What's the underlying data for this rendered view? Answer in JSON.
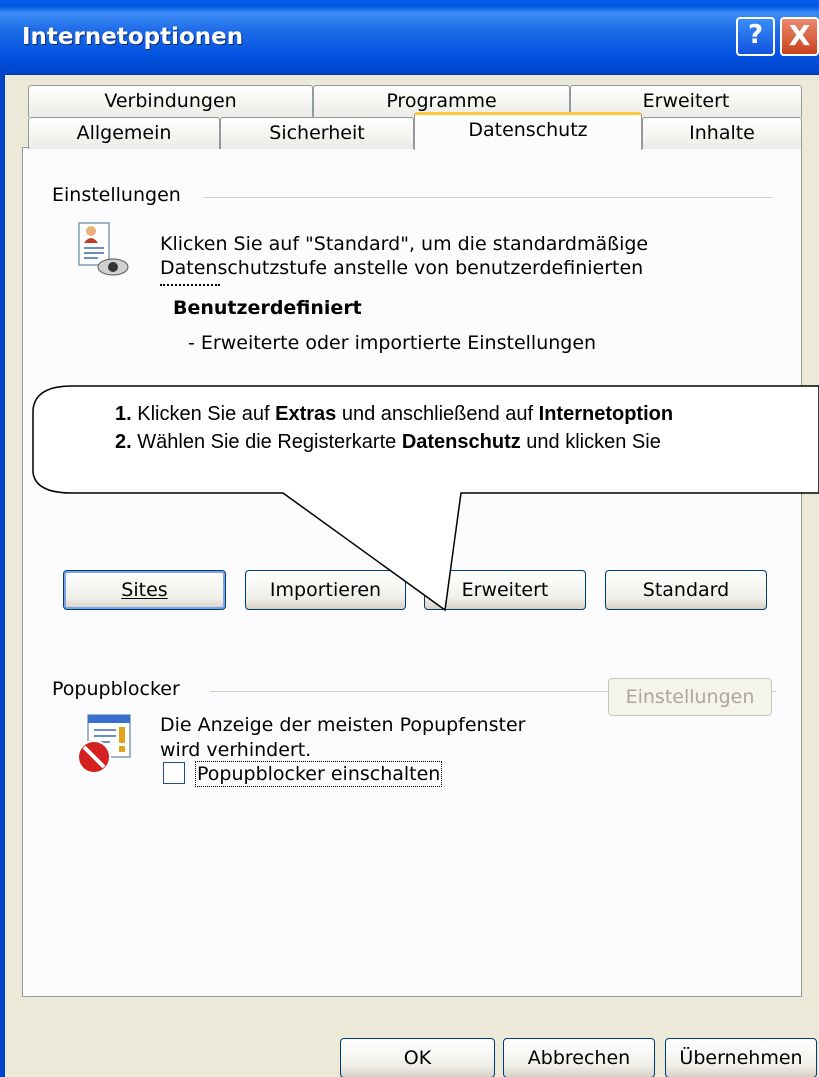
{
  "window": {
    "title": "Internetoptionen",
    "help_glyph": "?",
    "close_glyph": "X"
  },
  "tabs_back": [
    "Verbindungen",
    "Programme",
    "Erweitert"
  ],
  "tabs_front": [
    "Allgemein",
    "Sicherheit",
    "Datenschutz",
    "Inhalte"
  ],
  "active_tab": "Datenschutz",
  "settings": {
    "group_label": "Einstellungen",
    "desc_line1": "Klicken Sie auf \"Standard\", um die standardmäßige",
    "desc_line2": "Datenschutzstufe anstelle von benutzerdefinierten",
    "level_title": "Benutzerdefiniert",
    "level_desc": "- Erweiterte oder importierte Einstellungen"
  },
  "callout": {
    "line1_num": "1.",
    "line1_a": "Klicken Sie auf",
    "line1_b": "Extras",
    "line1_c": "und anschließend auf",
    "line1_d": "Internetoption",
    "line2_num": "2.",
    "line2_a": "Wählen Sie die Registerkarte",
    "line2_b": "Datenschutz",
    "line2_c": "und klicken Sie"
  },
  "buttons": {
    "sites": "Sites",
    "importieren": "Importieren",
    "erweitert": "Erweitert",
    "standard": "Standard",
    "einstellungen": "Einstellungen",
    "ok": "OK",
    "abbrechen": "Abbrechen",
    "uebernehmen": "Übernehmen"
  },
  "popup": {
    "group_label": "Popupblocker",
    "desc_line1": "Die Anzeige der meisten Popupfenster",
    "desc_line2": "wird verhindert.",
    "checkbox_label": "Popupblocker einschalten",
    "checkbox_checked": false
  },
  "colors": {
    "titlebar": "#0058E6",
    "dialog_bg": "#ECE9D8",
    "active_tab_accent": "#FFC83C"
  }
}
